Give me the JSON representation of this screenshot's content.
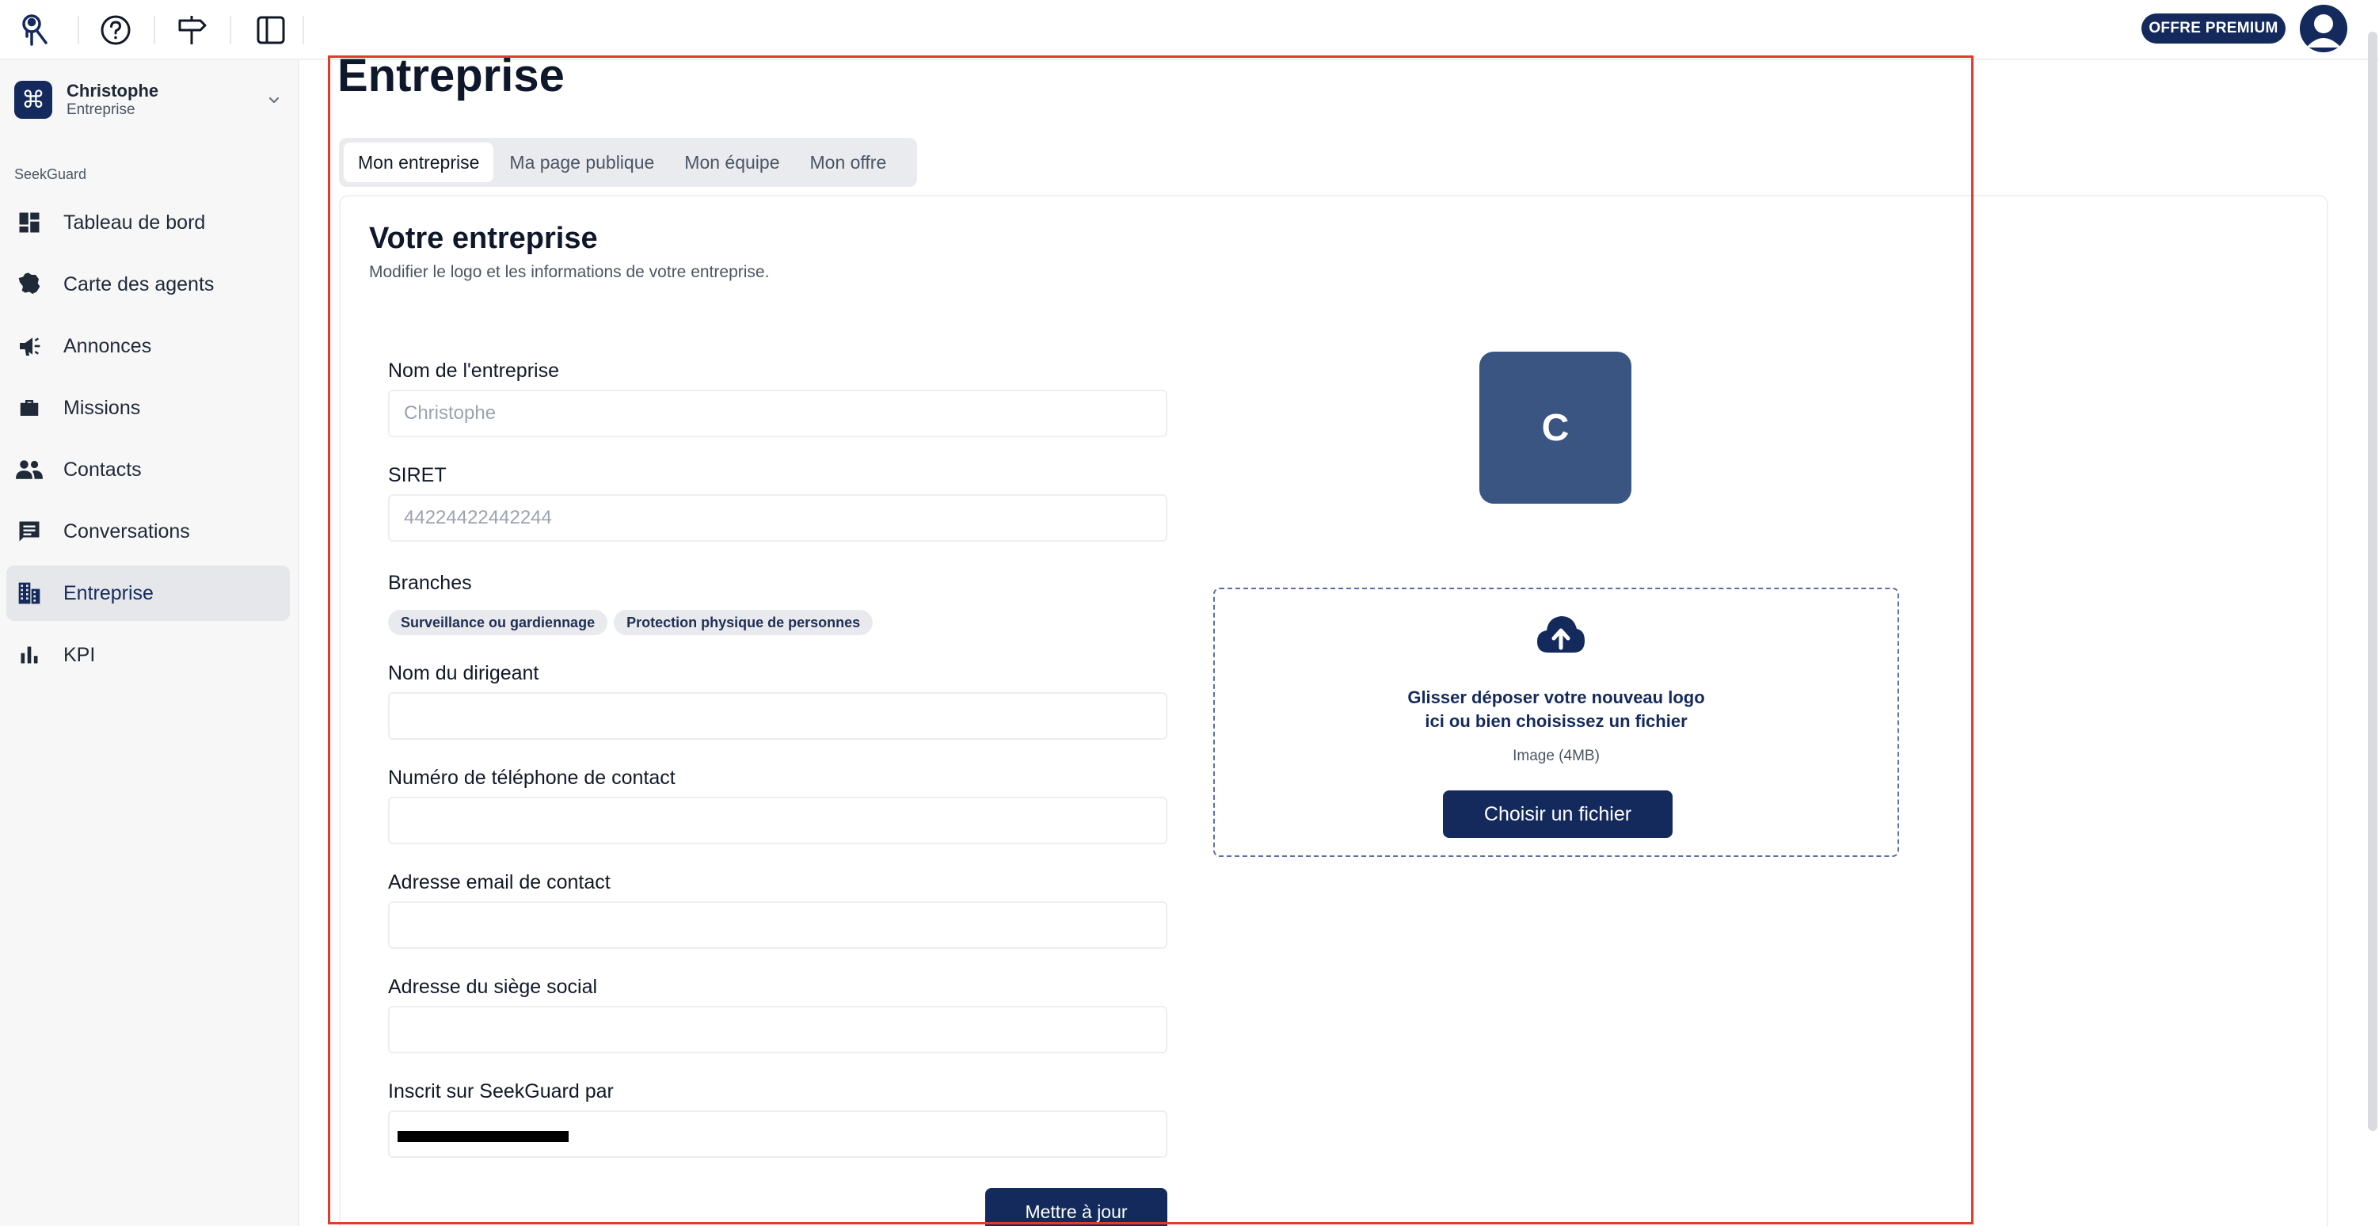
{
  "topbar": {
    "icons": [
      "app-logo-icon",
      "help-icon",
      "signpost-icon",
      "sidebar-toggle-icon"
    ],
    "premium_label": "OFFRE PREMIUM"
  },
  "sidebar": {
    "org_name": "Christophe",
    "org_type": "Entreprise",
    "section_label": "SeekGuard",
    "items": [
      {
        "label": "Tableau de bord",
        "icon": "dashboard-icon"
      },
      {
        "label": "Carte des agents",
        "icon": "map-france-icon"
      },
      {
        "label": "Annonces",
        "icon": "megaphone-icon"
      },
      {
        "label": "Missions",
        "icon": "briefcase-icon"
      },
      {
        "label": "Contacts",
        "icon": "people-icon"
      },
      {
        "label": "Conversations",
        "icon": "chat-icon"
      },
      {
        "label": "Entreprise",
        "icon": "building-icon",
        "active": true
      },
      {
        "label": "KPI",
        "icon": "bar-chart-icon"
      }
    ]
  },
  "main": {
    "page_title": "Entreprise",
    "tabs": [
      {
        "label": "Mon entreprise",
        "active": true
      },
      {
        "label": "Ma page publique"
      },
      {
        "label": "Mon équipe"
      },
      {
        "label": "Mon offre"
      }
    ],
    "card_title": "Votre entreprise",
    "card_subtitle": "Modifier le logo et les informations de votre entreprise.",
    "fields": {
      "company_name": {
        "label": "Nom de l'entreprise",
        "value": "Christophe"
      },
      "siret": {
        "label": "SIRET",
        "value": "44224422442244"
      },
      "branches": {
        "label": "Branches",
        "chips": [
          "Surveillance ou gardiennage",
          "Protection physique de personnes"
        ]
      },
      "director": {
        "label": "Nom du dirigeant",
        "value": ""
      },
      "phone": {
        "label": "Numéro de téléphone de contact",
        "value": ""
      },
      "email": {
        "label": "Adresse email de contact",
        "value": ""
      },
      "address": {
        "label": "Adresse du siège social",
        "value": ""
      },
      "referrer": {
        "label": "Inscrit sur SeekGuard par"
      }
    },
    "submit_label": "Mettre à jour",
    "logo": {
      "letter": "C",
      "drop_line1": "Glisser déposer votre nouveau logo",
      "drop_line2": "ici ou bien choisissez un fichier",
      "hint": "Image (4MB)",
      "button_label": "Choisir un fichier"
    }
  },
  "colors": {
    "brand": "#142a5c",
    "logo_bg": "#3b5583",
    "highlight": "#e23b2e"
  }
}
